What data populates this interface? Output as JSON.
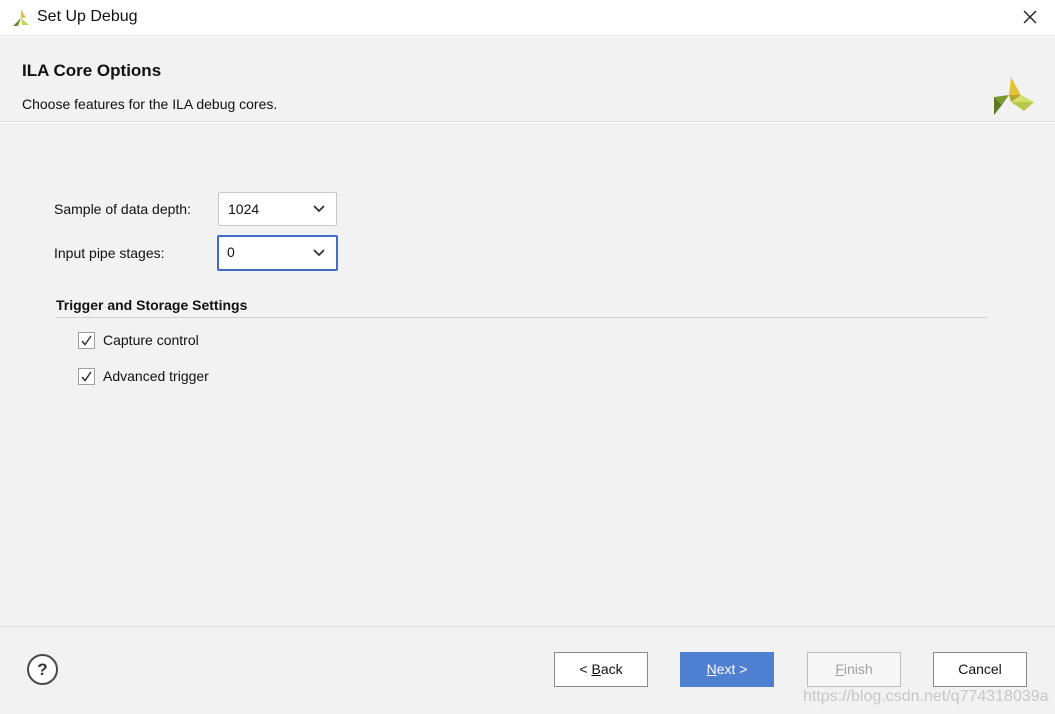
{
  "window": {
    "title": "Set Up Debug"
  },
  "header": {
    "title": "ILA Core Options",
    "subtitle": "Choose features for the ILA debug cores."
  },
  "fields": {
    "data_depth_label": "Sample of data depth:",
    "data_depth_value": "1024",
    "pipe_stages_label": "Input pipe stages:",
    "pipe_stages_value": "0"
  },
  "trigger_section": {
    "title": "Trigger and Storage Settings",
    "options": [
      {
        "label": "Capture control",
        "checked": true
      },
      {
        "label": "Advanced trigger",
        "checked": true
      }
    ]
  },
  "footer": {
    "help_label": "?",
    "back": {
      "mnemonic": "B",
      "rest": "ack",
      "prefix": "< "
    },
    "next": {
      "mnemonic": "N",
      "rest": "ext >"
    },
    "finish": {
      "mnemonic": "F",
      "rest": "inish"
    },
    "cancel_label": "Cancel",
    "watermark": "https://blog.csdn.net/q774318039a"
  },
  "colors": {
    "accent": "#4f7fd1",
    "logo_yellow": "#e0c53a",
    "logo_green": "#6f8a2a",
    "logo_light": "#c7d65a"
  }
}
